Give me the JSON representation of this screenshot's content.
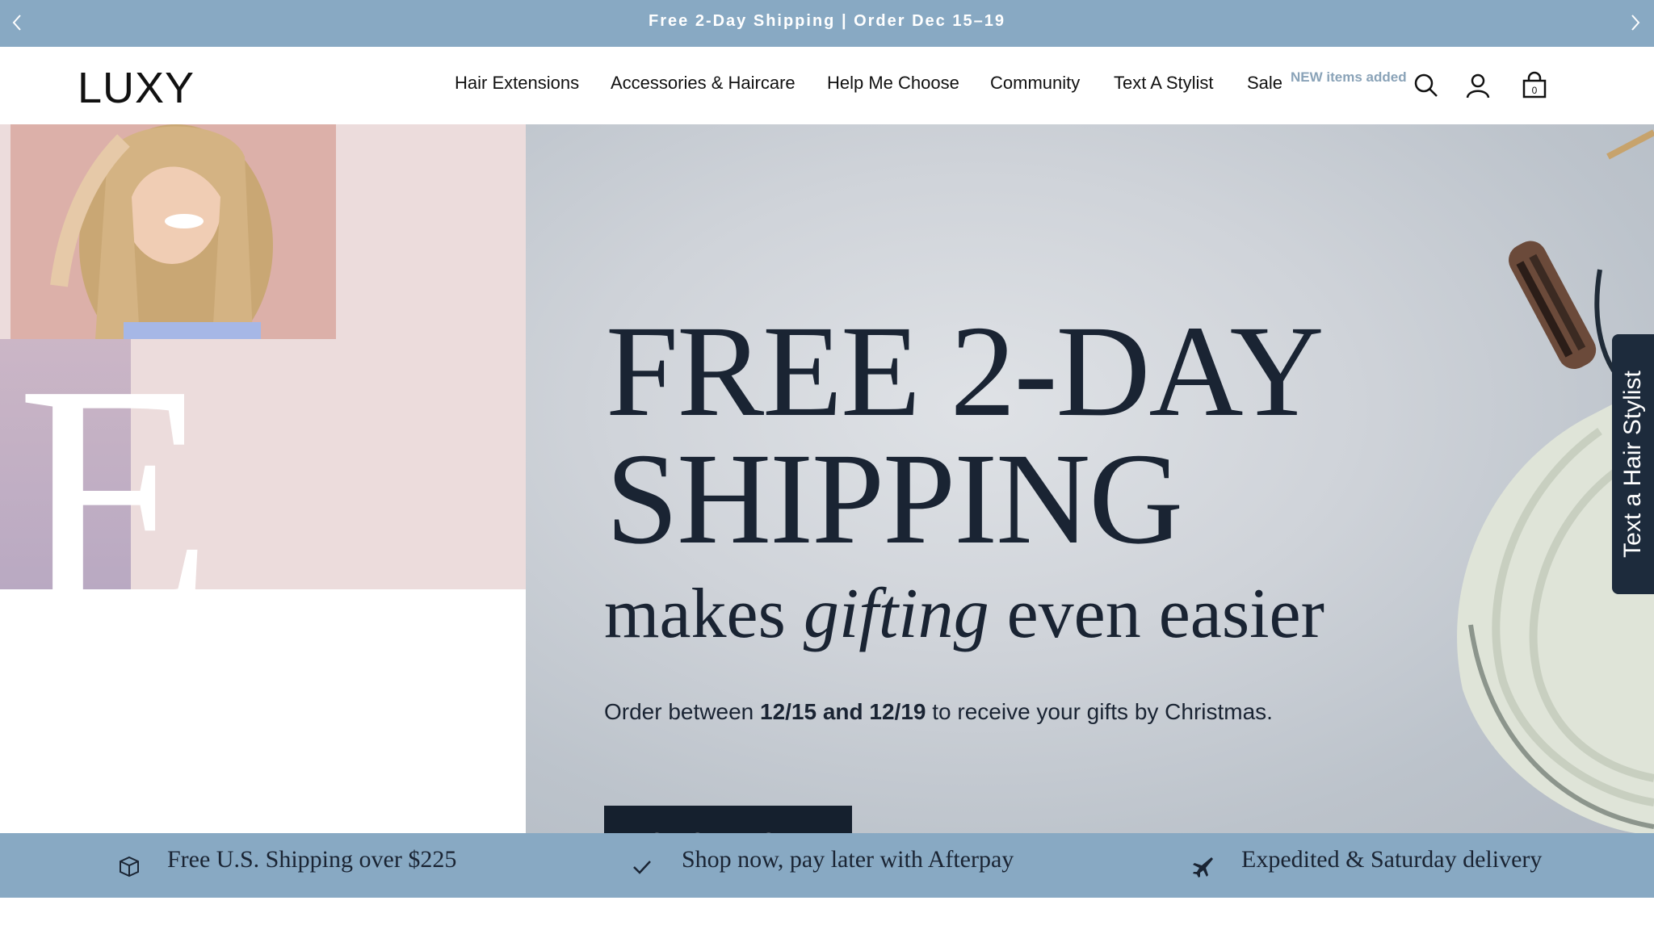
{
  "announcement": {
    "text": "Free 2-Day Shipping | Order Dec 15–19",
    "prev_icon": "chevron-left-icon",
    "next_icon": "chevron-right-icon"
  },
  "header": {
    "logo": "LUXY",
    "nav": [
      {
        "label": "Hair Extensions"
      },
      {
        "label": "Accessories & Haircare"
      },
      {
        "label": "Help Me Choose"
      },
      {
        "label": "Community"
      },
      {
        "label": "Text A Stylist"
      },
      {
        "label": "Sale"
      }
    ],
    "new_items_badge": "NEW items added",
    "icons": [
      "search-icon",
      "account-icon",
      "cart-icon"
    ],
    "cart_count": "0"
  },
  "hero": {
    "decorative_letter": "E",
    "headline_line1": "FREE 2-DAY",
    "headline_line2": "SHIPPING",
    "subhead_before": "makes ",
    "subhead_italic": "gifting",
    "subhead_after": " even easier",
    "order_prefix": "Order between ",
    "order_bold": "12/15 and 12/19",
    "order_suffix": " to receive your gifts by Christmas.",
    "cta": "SHOP NOW",
    "slide_count": 3,
    "active_slide": 2
  },
  "side_tab": {
    "label": "Text a Hair Stylist"
  },
  "benefits": [
    {
      "icon": "box-icon",
      "text": "Free U.S. Shipping over $225"
    },
    {
      "icon": "checkmark-icon",
      "text": "Shop now, pay later with Afterpay"
    },
    {
      "icon": "airplane-icon",
      "text": "Expedited & Saturday delivery"
    }
  ],
  "colors": {
    "accent_bar": "#88a9c3",
    "dark_navy": "#15202e",
    "headline": "#1a2433"
  }
}
